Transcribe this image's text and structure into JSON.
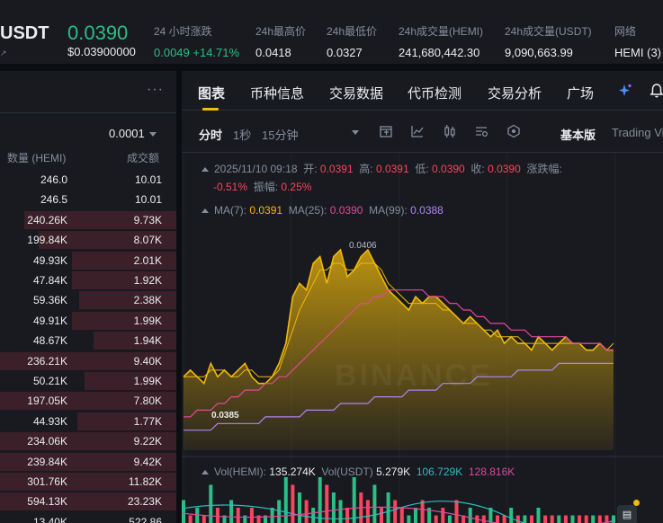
{
  "ticker": {
    "symbol": "USDT",
    "symbol_sub": "↗",
    "price": "0.0390",
    "price_usd": "$0.03900000",
    "stats": [
      {
        "label": "24 小时涨跌",
        "value": "0.0049 +14.71%",
        "color": "green"
      },
      {
        "label": "24h最高价",
        "value": "0.0418"
      },
      {
        "label": "24h最低价",
        "value": "0.0327"
      },
      {
        "label": "24h成交量(HEMI)",
        "value": "241,680,442.30"
      },
      {
        "label": "24h成交量(USDT)",
        "value": "9,090,663.99"
      },
      {
        "label": "网络",
        "value": "HEMI (3)"
      }
    ]
  },
  "orderbook": {
    "more_icon": "more-dots-icon",
    "precision": "0.0001",
    "headers": {
      "qty": "数量 (HEMI)",
      "amount": "成交额"
    },
    "rows": [
      {
        "qty": "246.0",
        "amount": "10.01",
        "depth": 0.0
      },
      {
        "qty": "246.5",
        "amount": "10.01",
        "depth": 0.0
      },
      {
        "qty": "240.26K",
        "amount": "9.73K",
        "depth": 0.86
      },
      {
        "qty": "199.84K",
        "amount": "8.07K",
        "depth": 0.78
      },
      {
        "qty": "49.93K",
        "amount": "2.01K",
        "depth": 0.59
      },
      {
        "qty": "47.84K",
        "amount": "1.92K",
        "depth": 0.59
      },
      {
        "qty": "59.36K",
        "amount": "2.38K",
        "depth": 0.55
      },
      {
        "qty": "49.91K",
        "amount": "1.99K",
        "depth": 0.59
      },
      {
        "qty": "48.67K",
        "amount": "1.94K",
        "depth": 0.47
      },
      {
        "qty": "236.21K",
        "amount": "9.40K",
        "depth": 1.0
      },
      {
        "qty": "50.21K",
        "amount": "1.99K",
        "depth": 0.52
      },
      {
        "qty": "197.05K",
        "amount": "7.80K",
        "depth": 1.0
      },
      {
        "qty": "44.93K",
        "amount": "1.77K",
        "depth": 0.56
      },
      {
        "qty": "234.06K",
        "amount": "9.22K",
        "depth": 1.0
      },
      {
        "qty": "239.84K",
        "amount": "9.42K",
        "depth": 1.0
      },
      {
        "qty": "301.76K",
        "amount": "11.82K",
        "depth": 1.0
      },
      {
        "qty": "594.13K",
        "amount": "23.23K",
        "depth": 1.0
      },
      {
        "qty": "13.40K",
        "amount": "522.86",
        "depth": 0.0
      }
    ]
  },
  "tabs": [
    {
      "label": "图表",
      "active": true
    },
    {
      "label": "币种信息"
    },
    {
      "label": "交易数据"
    },
    {
      "label": "代币检测"
    },
    {
      "label": "交易分析"
    },
    {
      "label": "广场"
    }
  ],
  "tab_icons": [
    "sparkle-ai-icon",
    "bell-icon"
  ],
  "toolbar": {
    "intervals": [
      {
        "label": "分时",
        "active": true
      },
      {
        "label": "1秒"
      },
      {
        "label": "15分钟"
      }
    ],
    "icons": [
      "indicator-icon",
      "draw-line-icon",
      "candle-type-icon",
      "settings-chart-icon",
      "layers-icon"
    ],
    "mode_basic": "基本版",
    "mode_tv": "Trading View"
  },
  "chart_info": {
    "datetime": "2025/11/10 09:18",
    "open_label": "开:",
    "open": "0.0391",
    "high_label": "高:",
    "high": "0.0391",
    "low_label": "低:",
    "low": "0.0390",
    "close_label": "收:",
    "close": "0.0390",
    "change_label": "涨跌幅:",
    "change": "-0.51%",
    "amp_label": "振幅:",
    "amp": "0.25%",
    "ma7_label": "MA(7):",
    "ma7": "0.0391",
    "ma25_label": "MA(25):",
    "ma25": "0.0390",
    "ma99_label": "MA(99):",
    "ma99": "0.0388",
    "max_label": "0.0406",
    "min_label": "0.0385",
    "watermark": "BINANCE",
    "vol_hemi_label": "Vol(HEMI):",
    "vol_hemi": "135.274K",
    "vol_usdt_label": "Vol(USDT)",
    "vol_usdt": "5.279K",
    "vol_ma1": "106.729K",
    "vol_ma2": "128.816K"
  },
  "colors": {
    "up": "#2ebd85",
    "down": "#f6465d",
    "accent": "#f0b90b",
    "ma25": "#e0489a",
    "ma99": "#b084f0"
  },
  "chart_data": {
    "type": "area",
    "title": "",
    "series": [
      {
        "name": "Price",
        "values": [
          0.0386,
          0.0387,
          0.0386,
          0.0385,
          0.0388,
          0.0386,
          0.0387,
          0.0386,
          0.0387,
          0.0388,
          0.0386,
          0.0385,
          0.0385,
          0.0386,
          0.0388,
          0.0391,
          0.0398,
          0.04,
          0.0399,
          0.0403,
          0.0404,
          0.04,
          0.0404,
          0.0405,
          0.0401,
          0.0402,
          0.0404,
          0.0405,
          0.0403,
          0.0401,
          0.0399,
          0.0398,
          0.0397,
          0.0396,
          0.0398,
          0.0397,
          0.0398,
          0.0398,
          0.0397,
          0.0396,
          0.0395,
          0.0394,
          0.0395,
          0.0394,
          0.0393,
          0.0392,
          0.0393,
          0.0391,
          0.0392,
          0.0391,
          0.0391,
          0.039,
          0.0392,
          0.0391,
          0.039,
          0.0391,
          0.0392,
          0.0391,
          0.0391,
          0.039,
          0.039,
          0.0391,
          0.039,
          0.039
        ]
      },
      {
        "name": "MA(7)",
        "values": [
          0.0386,
          0.0386,
          0.0386,
          0.0386,
          0.0387,
          0.0387,
          0.0387,
          0.0386,
          0.0386,
          0.0387,
          0.0387,
          0.0386,
          0.0386,
          0.0386,
          0.0387,
          0.039,
          0.0393,
          0.0396,
          0.0398,
          0.04,
          0.0402,
          0.0402,
          0.0403,
          0.0403,
          0.0402,
          0.0402,
          0.0403,
          0.0403,
          0.0403,
          0.0402,
          0.04,
          0.0399,
          0.0398,
          0.0397,
          0.0397,
          0.0397,
          0.0397,
          0.0397,
          0.0396,
          0.0396,
          0.0395,
          0.0394,
          0.0394,
          0.0394,
          0.0393,
          0.0393,
          0.0392,
          0.0392,
          0.0392,
          0.0392,
          0.0391,
          0.0391,
          0.0391,
          0.0391,
          0.0391,
          0.0391,
          0.0391,
          0.0391,
          0.0391,
          0.0391,
          0.0391,
          0.0391,
          0.039,
          0.0391
        ]
      },
      {
        "name": "MA(25)",
        "values": [
          0.038,
          0.038,
          0.0381,
          0.0381,
          0.0381,
          0.0382,
          0.0382,
          0.0383,
          0.0383,
          0.0384,
          0.0384,
          0.0384,
          0.0385,
          0.0385,
          0.0386,
          0.0386,
          0.0387,
          0.0388,
          0.0389,
          0.039,
          0.0391,
          0.0392,
          0.0393,
          0.0394,
          0.0395,
          0.0396,
          0.0397,
          0.0397,
          0.0398,
          0.0398,
          0.0399,
          0.0399,
          0.0399,
          0.0399,
          0.0399,
          0.0399,
          0.0398,
          0.0398,
          0.0398,
          0.0397,
          0.0397,
          0.0396,
          0.0396,
          0.0395,
          0.0395,
          0.0394,
          0.0394,
          0.0394,
          0.0393,
          0.0393,
          0.0393,
          0.0392,
          0.0392,
          0.0392,
          0.0392,
          0.0392,
          0.0392,
          0.0391,
          0.0391,
          0.0391,
          0.0391,
          0.0391,
          0.039,
          0.039
        ]
      },
      {
        "name": "MA(99)",
        "values": [
          0.0378,
          0.0378,
          0.0378,
          0.0378,
          0.0378,
          0.0379,
          0.0379,
          0.0379,
          0.0379,
          0.0379,
          0.0379,
          0.0379,
          0.038,
          0.038,
          0.038,
          0.038,
          0.038,
          0.038,
          0.0381,
          0.0381,
          0.0381,
          0.0381,
          0.0381,
          0.0382,
          0.0382,
          0.0382,
          0.0382,
          0.0382,
          0.0383,
          0.0383,
          0.0383,
          0.0383,
          0.0383,
          0.0384,
          0.0384,
          0.0384,
          0.0384,
          0.0384,
          0.0385,
          0.0385,
          0.0385,
          0.0385,
          0.0385,
          0.0386,
          0.0386,
          0.0386,
          0.0386,
          0.0386,
          0.0386,
          0.0387,
          0.0387,
          0.0387,
          0.0387,
          0.0387,
          0.0387,
          0.0388,
          0.0388,
          0.0388,
          0.0388,
          0.0388,
          0.0388,
          0.0388,
          0.0388,
          0.0388
        ]
      }
    ],
    "ylim": [
      0.0375,
      0.041
    ],
    "volume": {
      "values": [
        3,
        1,
        2,
        1,
        5,
        2,
        1,
        3,
        2,
        1,
        2,
        1,
        1,
        2,
        3,
        6,
        5,
        4,
        3,
        2,
        6,
        5,
        4,
        3,
        2,
        6,
        4,
        3,
        5,
        2,
        4,
        3,
        2,
        1,
        2,
        3,
        2,
        1,
        2,
        1,
        3,
        1,
        2,
        1,
        1,
        2,
        1,
        1,
        2,
        1,
        1,
        1,
        2,
        1,
        1,
        1,
        1,
        1,
        1,
        1,
        1,
        1,
        1,
        1
      ],
      "up": [
        true,
        false,
        true,
        false,
        true,
        false,
        true,
        true,
        false,
        true,
        false,
        false,
        true,
        true,
        true,
        true,
        false,
        true,
        false,
        true,
        true,
        false,
        true,
        true,
        false,
        true,
        false,
        false,
        true,
        false,
        true,
        false,
        false,
        true,
        true,
        false,
        true,
        false,
        false,
        true,
        false,
        false,
        true,
        false,
        false,
        true,
        false,
        false,
        true,
        false,
        true,
        false,
        true,
        false,
        false,
        true,
        false,
        true,
        false,
        false,
        true,
        false,
        false,
        true
      ]
    }
  }
}
